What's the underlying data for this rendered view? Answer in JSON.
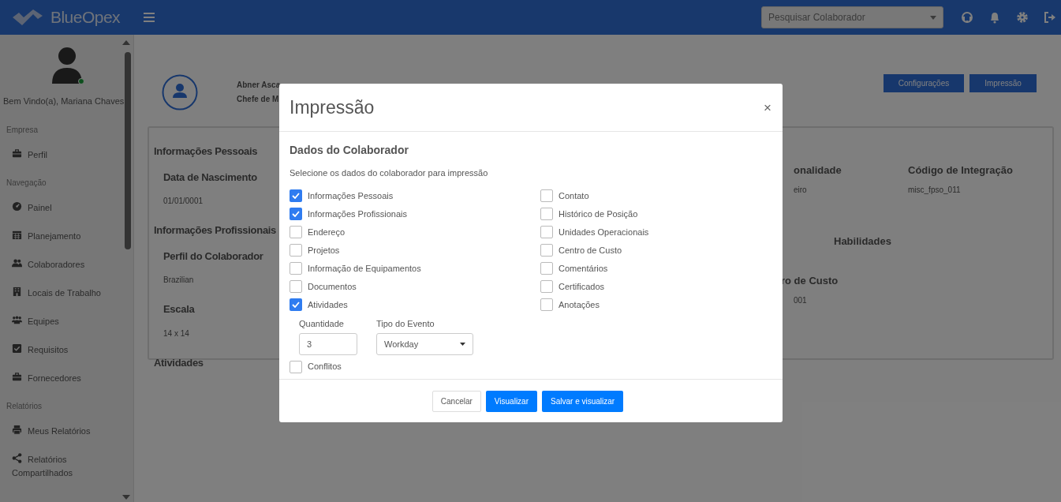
{
  "header": {
    "brand": "BlueOpex",
    "search": {
      "placeholder": "Pesquisar Colaborador"
    }
  },
  "sidebar": {
    "greeting": "Bem Vindo(a), Mariana Chaves",
    "online": true,
    "sections": [
      {
        "title": "Empresa",
        "items": [
          {
            "label": "Perfil"
          }
        ]
      },
      {
        "title": "Navegação",
        "items": [
          {
            "label": "Painel"
          },
          {
            "label": "Planejamento"
          },
          {
            "label": "Colaboradores"
          },
          {
            "label": "Locais de Trabalho"
          },
          {
            "label": "Equipes"
          },
          {
            "label": "Requisitos"
          },
          {
            "label": "Fornecedores"
          }
        ]
      },
      {
        "title": "Relatórios",
        "items": [
          {
            "label": "Meus Relatórios"
          },
          {
            "label": "Relatórios Compartilhados"
          }
        ]
      }
    ]
  },
  "profile": {
    "name": "Abner Asca",
    "role": "Chefe de M",
    "buttons": [
      "Configurações",
      "Impressão"
    ]
  },
  "card": {
    "left": [
      {
        "kind": "section",
        "text": "Informações Pessoais"
      },
      {
        "kind": "label",
        "text": "Data de Nascimento"
      },
      {
        "kind": "value",
        "text": "01/01/0001"
      },
      {
        "kind": "section",
        "text": "Informações Profissionais"
      },
      {
        "kind": "label",
        "text": "Perfil do Colaborador"
      },
      {
        "kind": "value",
        "text": "Brazilian"
      },
      {
        "kind": "label",
        "text": "Escala"
      },
      {
        "kind": "value",
        "text": "14 x 14"
      },
      {
        "kind": "section",
        "text": "Atividades"
      }
    ],
    "right": [
      {
        "kind": "label",
        "text": "onalidade"
      },
      {
        "kind": "value",
        "text": "eiro"
      },
      {
        "kind": "label",
        "text": "Código de Integração"
      },
      {
        "kind": "value",
        "text": "misc_fpso_011"
      },
      {
        "kind": "label",
        "text": "Habilidades"
      },
      {
        "kind": "label",
        "text": "ro de Custo"
      },
      {
        "kind": "value",
        "text": "001"
      }
    ]
  },
  "modal": {
    "title": "Impressão",
    "close": "×",
    "heading": "Dados do Colaborador",
    "hint": "Selecione os dados do colaborador para impressão",
    "options_left": [
      {
        "label": "Informações Pessoais",
        "checked": true
      },
      {
        "label": "Informações Profissionais",
        "checked": true
      },
      {
        "label": "Endereço",
        "checked": false
      },
      {
        "label": "Projetos",
        "checked": false
      },
      {
        "label": "Informação de Equipamentos",
        "checked": false
      },
      {
        "label": "Documentos",
        "checked": false
      },
      {
        "label": "Atividades",
        "checked": true
      }
    ],
    "options_right": [
      {
        "label": "Contato",
        "checked": false
      },
      {
        "label": "Histórico de Posição",
        "checked": false
      },
      {
        "label": "Unidades Operacionais",
        "checked": false
      },
      {
        "label": "Centro de Custo",
        "checked": false
      },
      {
        "label": "Comentários",
        "checked": false
      },
      {
        "label": "Certificados",
        "checked": false
      },
      {
        "label": "Anotações",
        "checked": false
      }
    ],
    "quantity": {
      "label": "Quantidade",
      "value": "3"
    },
    "event_type": {
      "label": "Tipo do Evento",
      "value": "Workday"
    },
    "conflicts": {
      "label": "Conflitos",
      "checked": false
    },
    "buttons": [
      {
        "label": "Cancelar",
        "kind": "secondary"
      },
      {
        "label": "Visualizar",
        "kind": "primary"
      },
      {
        "label": "Salvar e visualizar",
        "kind": "primary"
      }
    ]
  }
}
